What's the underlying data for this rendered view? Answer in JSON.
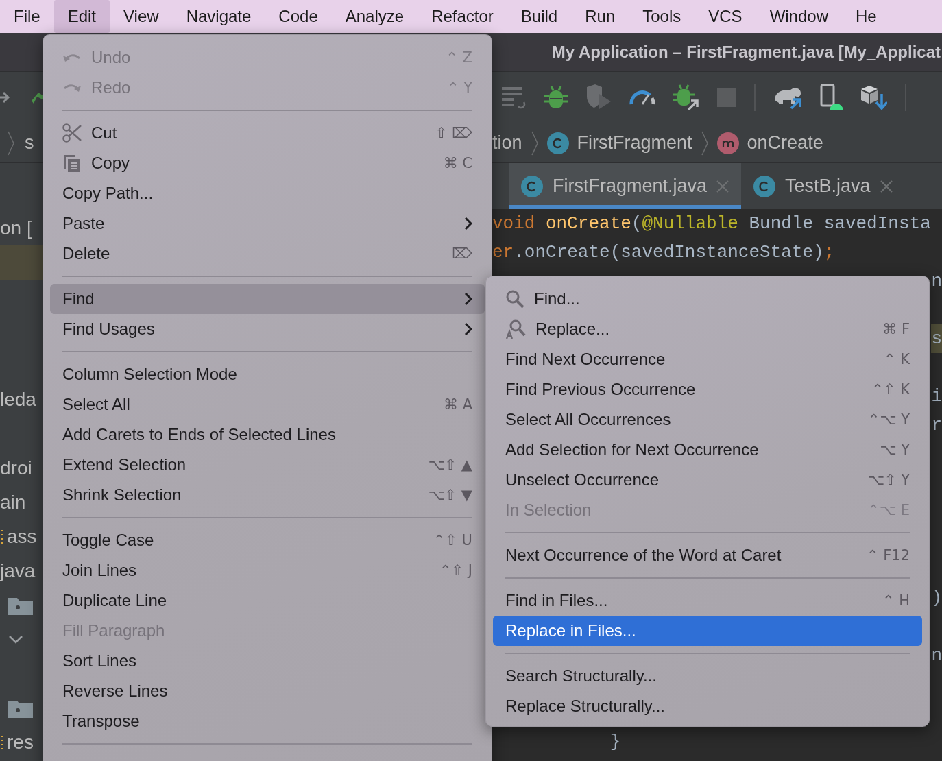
{
  "menubar": [
    {
      "label": "File",
      "selected": false
    },
    {
      "label": "Edit",
      "selected": true
    },
    {
      "label": "View",
      "selected": false
    },
    {
      "label": "Navigate",
      "selected": false
    },
    {
      "label": "Code",
      "selected": false
    },
    {
      "label": "Analyze",
      "selected": false
    },
    {
      "label": "Refactor",
      "selected": false
    },
    {
      "label": "Build",
      "selected": false
    },
    {
      "label": "Run",
      "selected": false
    },
    {
      "label": "Tools",
      "selected": false
    },
    {
      "label": "VCS",
      "selected": false
    },
    {
      "label": "Window",
      "selected": false
    },
    {
      "label": "He",
      "selected": false
    }
  ],
  "window": {
    "title": "My Application – FirstFragment.java [My_Applicat"
  },
  "breadcrumb": {
    "left": "s",
    "items": [
      {
        "label": "tion",
        "kind": "plain"
      },
      {
        "label": "FirstFragment",
        "kind": "class"
      },
      {
        "label": "onCreate",
        "kind": "method"
      }
    ]
  },
  "tabs": [
    {
      "label": "FirstFragment.java",
      "selected": true
    },
    {
      "label": "TestB.java",
      "selected": false
    }
  ],
  "project_rows": [
    {
      "kind": "text",
      "label": "on ["
    },
    {
      "kind": "highlight"
    },
    {
      "kind": "blank"
    },
    {
      "kind": "blank"
    },
    {
      "kind": "blank"
    },
    {
      "kind": "text",
      "label": "leda"
    },
    {
      "kind": "blank"
    },
    {
      "kind": "text",
      "label": "droi"
    },
    {
      "kind": "text",
      "label": "ain"
    },
    {
      "kind": "resource",
      "label": "ass"
    },
    {
      "kind": "text",
      "label": "java"
    },
    {
      "kind": "folder"
    },
    {
      "kind": "chevron"
    },
    {
      "kind": "blank"
    },
    {
      "kind": "folder"
    },
    {
      "kind": "resource",
      "label": "res"
    }
  ],
  "code_lines": [
    {
      "kind": "code",
      "tokens": [
        {
          "text": "void ",
          "kind": "keyword"
        },
        {
          "text": "onCreate",
          "kind": "method"
        },
        {
          "text": "(",
          "kind": "plain"
        },
        {
          "text": "@Nullable",
          "kind": "annotation"
        },
        {
          "text": " Bundle savedInsta",
          "kind": "plain"
        }
      ]
    },
    {
      "kind": "code",
      "tokens": [
        {
          "text": "er",
          "kind": "keyword"
        },
        {
          "text": ".onCreate(savedInstanceState)",
          "kind": "plain"
        },
        {
          "text": ";",
          "kind": "keyword"
        }
      ]
    },
    {
      "kind": "edge",
      "text": "n",
      "highlighted": false
    },
    {
      "kind": "blank"
    },
    {
      "kind": "edge",
      "text": "s",
      "highlighted": true
    },
    {
      "kind": "blank"
    },
    {
      "kind": "edge",
      "text": "i",
      "highlighted": false
    },
    {
      "kind": "edge",
      "text": "r",
      "highlighted": false
    },
    {
      "kind": "blank"
    },
    {
      "kind": "blank"
    },
    {
      "kind": "blank"
    },
    {
      "kind": "blank"
    },
    {
      "kind": "blank"
    },
    {
      "kind": "edge",
      "text": ")",
      "highlighted": false
    },
    {
      "kind": "blank"
    },
    {
      "kind": "edge",
      "text": "n",
      "highlighted": false
    },
    {
      "kind": "blank"
    },
    {
      "kind": "blank"
    },
    {
      "kind": "code",
      "tokens": [
        {
          "text": "           }",
          "kind": "plain"
        }
      ]
    }
  ],
  "edit_menu": {
    "continues": true,
    "groups": [
      [
        {
          "kind": "undo",
          "label": "Undo",
          "shortcut": "⌃ Z",
          "disabled": true,
          "selected": false,
          "submenu": false
        },
        {
          "kind": "redo",
          "label": "Redo",
          "shortcut": "⌃ Y",
          "disabled": true,
          "selected": false,
          "submenu": false
        }
      ],
      [
        {
          "kind": "cut",
          "label": "Cut",
          "shortcut": "⇧ ⌦",
          "disabled": false,
          "selected": false,
          "submenu": false
        },
        {
          "kind": "copy",
          "label": "Copy",
          "shortcut": "⌘ C",
          "disabled": false,
          "selected": false,
          "submenu": false
        },
        {
          "kind": "plain",
          "label": "Copy Path...",
          "disabled": false,
          "selected": false,
          "submenu": false
        },
        {
          "kind": "plain",
          "label": "Paste",
          "disabled": false,
          "selected": false,
          "submenu": true
        },
        {
          "kind": "plain",
          "label": "Delete",
          "shortcut": "⌦",
          "disabled": false,
          "selected": false,
          "submenu": false
        }
      ],
      [
        {
          "kind": "plain",
          "label": "Find",
          "disabled": false,
          "selected": true,
          "submenu": true
        },
        {
          "kind": "plain",
          "label": "Find Usages",
          "disabled": false,
          "selected": false,
          "submenu": true
        }
      ],
      [
        {
          "kind": "plain",
          "label": "Column Selection Mode",
          "disabled": false,
          "selected": false,
          "submenu": false
        },
        {
          "kind": "plain",
          "label": "Select All",
          "shortcut": "⌘ A",
          "disabled": false,
          "selected": false,
          "submenu": false
        },
        {
          "kind": "plain",
          "label": "Add Carets to Ends of Selected Lines",
          "disabled": false,
          "selected": false,
          "submenu": false
        },
        {
          "kind": "plain",
          "label": "Extend Selection",
          "shortcut": "⌥⇧ ▲",
          "disabled": false,
          "selected": false,
          "submenu": false
        },
        {
          "kind": "plain",
          "label": "Shrink Selection",
          "shortcut": "⌥⇧ ▼",
          "disabled": false,
          "selected": false,
          "submenu": false
        }
      ],
      [
        {
          "kind": "plain",
          "label": "Toggle Case",
          "shortcut": "⌃⇧ U",
          "disabled": false,
          "selected": false,
          "submenu": false
        },
        {
          "kind": "plain",
          "label": "Join Lines",
          "shortcut": "⌃⇧ J",
          "disabled": false,
          "selected": false,
          "submenu": false
        },
        {
          "kind": "plain",
          "label": "Duplicate Line",
          "disabled": false,
          "selected": false,
          "submenu": false
        },
        {
          "kind": "plain",
          "label": "Fill Paragraph",
          "disabled": true,
          "selected": false,
          "submenu": false
        },
        {
          "kind": "plain",
          "label": "Sort Lines",
          "disabled": false,
          "selected": false,
          "submenu": false
        },
        {
          "kind": "plain",
          "label": "Reverse Lines",
          "disabled": false,
          "selected": false,
          "submenu": false
        },
        {
          "kind": "plain",
          "label": "Transpose",
          "disabled": false,
          "selected": false,
          "submenu": false
        }
      ]
    ]
  },
  "find_submenu": {
    "groups": [
      [
        {
          "kind": "search",
          "label": "Find...",
          "disabled": false,
          "selected": false,
          "submenu": false
        },
        {
          "kind": "replace",
          "label": "Replace...",
          "shortcut": "⌘ F",
          "disabled": false,
          "selected": false,
          "submenu": false
        },
        {
          "kind": "plain",
          "label": "Find Next Occurrence",
          "shortcut": "⌃ K",
          "disabled": false,
          "selected": false,
          "submenu": false
        },
        {
          "kind": "plain",
          "label": "Find Previous Occurrence",
          "shortcut": "⌃⇧ K",
          "disabled": false,
          "selected": false,
          "submenu": false
        },
        {
          "kind": "plain",
          "label": "Select All Occurrences",
          "shortcut": "⌃⌥ Y",
          "disabled": false,
          "selected": false,
          "submenu": false
        },
        {
          "kind": "plain",
          "label": "Add Selection for Next Occurrence",
          "shortcut": "⌥ Y",
          "disabled": false,
          "selected": false,
          "submenu": false
        },
        {
          "kind": "plain",
          "label": "Unselect Occurrence",
          "shortcut": "⌥⇧ Y",
          "disabled": false,
          "selected": false,
          "submenu": false
        },
        {
          "kind": "plain",
          "label": "In Selection",
          "shortcut": "⌃⌥ E",
          "disabled": true,
          "selected": false,
          "submenu": false
        }
      ],
      [
        {
          "kind": "plain",
          "label": "Next Occurrence of the Word at Caret",
          "shortcut": "⌃ F12",
          "disabled": false,
          "selected": false,
          "submenu": false
        }
      ],
      [
        {
          "kind": "plain",
          "label": "Find in Files...",
          "shortcut": "⌃ H",
          "disabled": false,
          "selected": false,
          "submenu": false
        },
        {
          "kind": "plain",
          "label": "Replace in Files...",
          "disabled": false,
          "selected": true,
          "submenu": false
        }
      ],
      [
        {
          "kind": "plain",
          "label": "Search Structurally...",
          "disabled": false,
          "selected": false,
          "submenu": false
        },
        {
          "kind": "plain",
          "label": "Replace Structurally...",
          "disabled": false,
          "selected": false,
          "submenu": false
        }
      ]
    ]
  }
}
